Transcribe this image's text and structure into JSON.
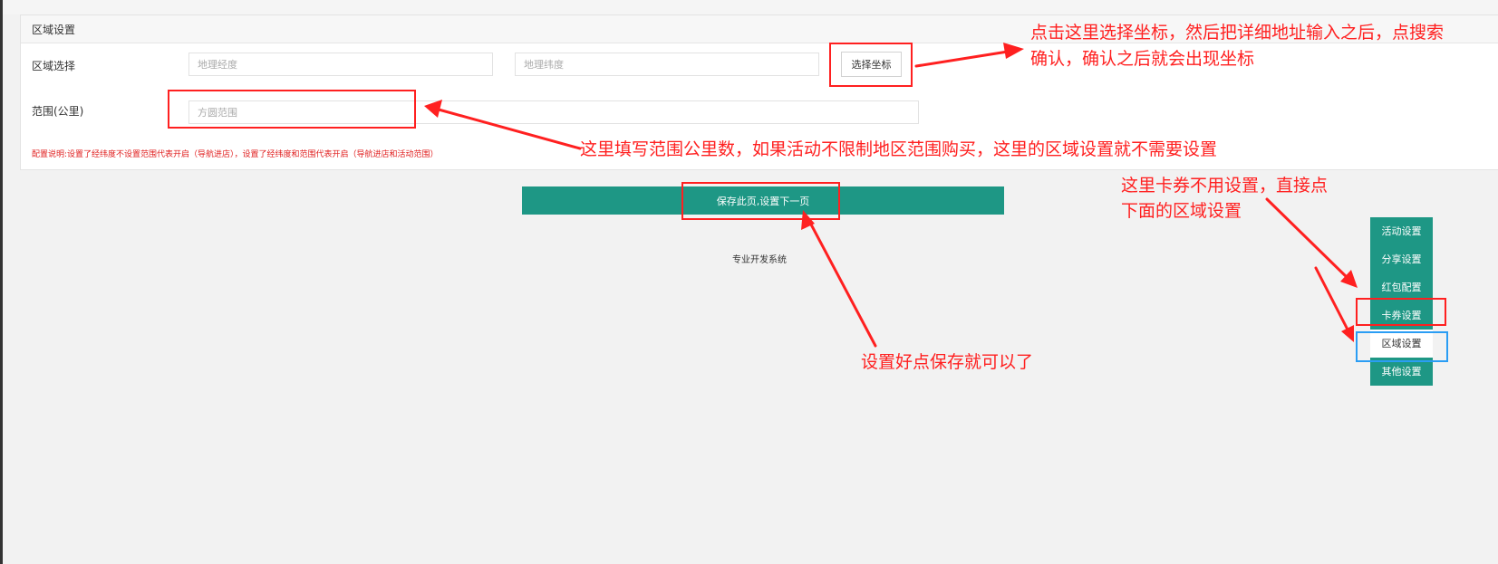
{
  "panel": {
    "title": "区域设置",
    "region_label": "区域选择",
    "longitude_placeholder": "地理经度",
    "latitude_placeholder": "地理纬度",
    "select_coords_label": "选择坐标",
    "range_label": "范围(公里)",
    "range_placeholder": "方圆范围",
    "note": "配置说明:设置了经纬度不设置范围代表开启（导航进店），设置了经纬度和范围代表开启（导航进店和活动范围）"
  },
  "save_button_label": "保存此页,设置下一页",
  "footer_text": "专业开发系统",
  "side_nav": [
    {
      "label": "活动设置",
      "active": false
    },
    {
      "label": "分享设置",
      "active": false
    },
    {
      "label": "红包配置",
      "active": false
    },
    {
      "label": "卡券设置",
      "active": false
    },
    {
      "label": "区域设置",
      "active": true
    },
    {
      "label": "其他设置",
      "active": false
    }
  ],
  "annotations": {
    "coords_line1": "点击这里选择坐标，然后把详细地址输入之后，点搜索",
    "coords_line2": "确认，确认之后就会出现坐标",
    "range": "这里填写范围公里数，如果活动不限制地区范围购买，这里的区域设置就不需要设置",
    "coupon_line1": "这里卡券不用设置，直接点",
    "coupon_line2": "下面的区域设置",
    "save": "设置好点保存就可以了",
    "color": "#ff2020",
    "highlight_color": "#2a9df4"
  },
  "colors": {
    "primary": "#1e9785",
    "background": "#f2f2f2",
    "note": "#e01e1e"
  }
}
